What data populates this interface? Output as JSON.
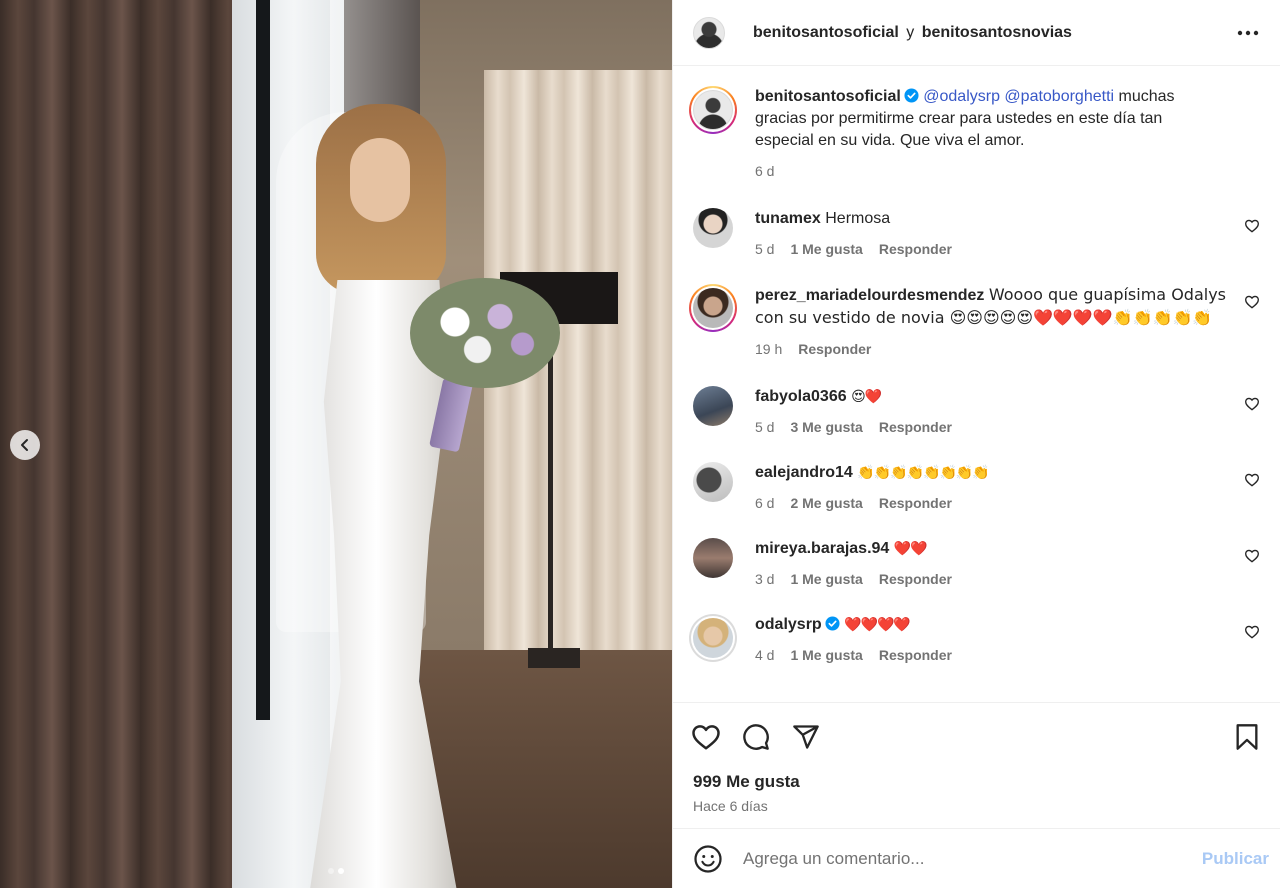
{
  "header": {
    "account_1": "benitosantosoficial",
    "connector": "y",
    "account_2": "benitosantosnovias"
  },
  "caption": {
    "username": "benitosantosoficial",
    "mention_1": "@odalysrp",
    "mention_2": "@patoborghetti",
    "text": "muchas gracias por permitirme crear para ustedes en este día tan especial en su vida. Que viva el amor.",
    "time": "6 d"
  },
  "comments": [
    {
      "username": "tunamex",
      "text": "Hermosa",
      "time": "5 d",
      "likes": "1 Me gusta",
      "reply": "Responder",
      "verified": false
    },
    {
      "username": "perez_mariadelourdesmendez",
      "text": "Woooo que guapísima Odalys con su vestido de novia 😍😍😍😍😍❤️❤️❤️❤️👏👏👏👏👏",
      "time": "19 h",
      "likes": "",
      "reply": "Responder",
      "verified": false
    },
    {
      "username": "fabyola0366",
      "text": "😍❤️",
      "time": "5 d",
      "likes": "3 Me gusta",
      "reply": "Responder",
      "verified": false
    },
    {
      "username": "ealejandro14",
      "text": "👏👏👏👏👏👏👏👏",
      "time": "6 d",
      "likes": "2 Me gusta",
      "reply": "Responder",
      "verified": false
    },
    {
      "username": "mireya.barajas.94",
      "text": "❤️❤️",
      "time": "3 d",
      "likes": "1 Me gusta",
      "reply": "Responder",
      "verified": false
    },
    {
      "username": "odalysrp",
      "text": "❤️❤️❤️❤️",
      "time": "4 d",
      "likes": "1 Me gusta",
      "reply": "Responder",
      "verified": true
    }
  ],
  "post": {
    "likes": "999 Me gusta",
    "posted": "Hace 6 días"
  },
  "add_comment": {
    "placeholder": "Agrega un comentario...",
    "post_label": "Publicar"
  },
  "colors": {
    "mention": "#3858c7",
    "verified": "#0095f6",
    "publish_disabled": "#a9c9f5"
  },
  "carousel": {
    "count": 2,
    "active": 2
  }
}
